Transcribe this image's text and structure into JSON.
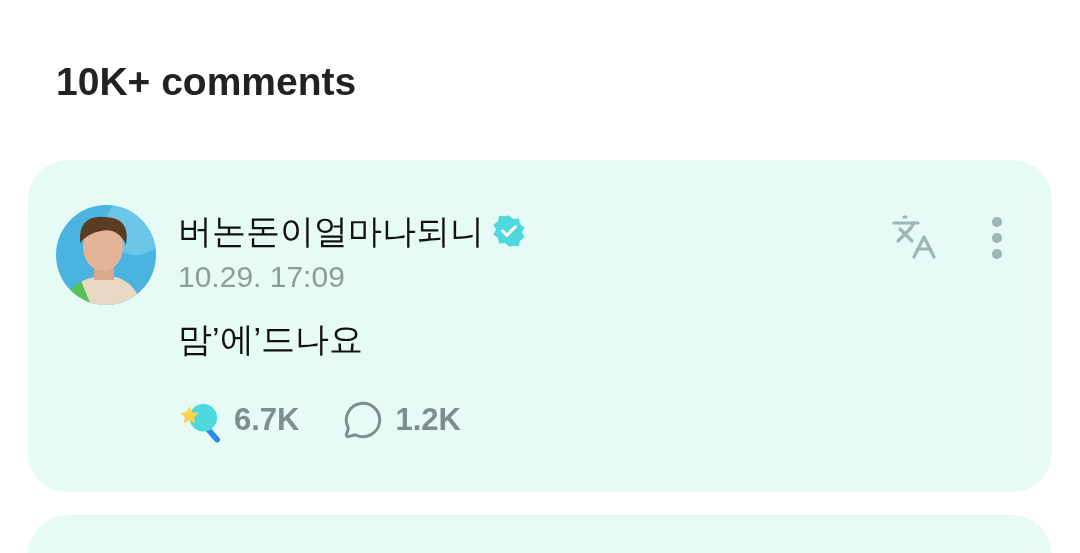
{
  "heading": "10K+ comments",
  "comments": [
    {
      "kind": "comment",
      "author": "버논돈이얼마나되니",
      "verified": true,
      "date": "10.29. 17:09",
      "text": "맘’에’드나요",
      "likes": "6.7K",
      "replies": "1.2K"
    },
    {
      "kind": "partial"
    }
  ]
}
